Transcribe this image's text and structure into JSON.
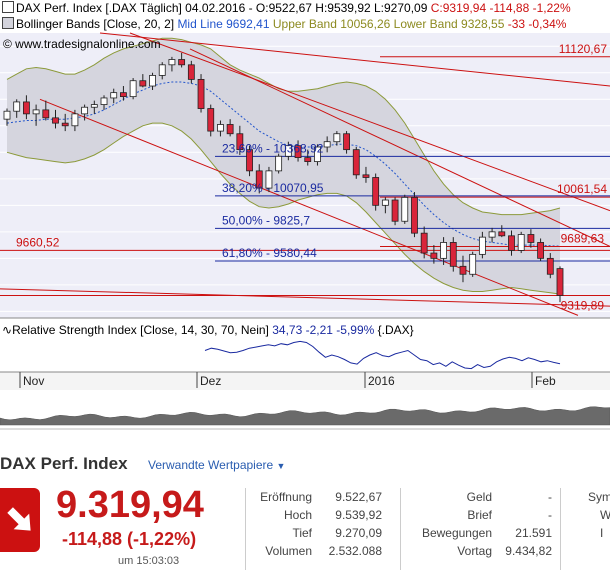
{
  "header": {
    "main_legend": "DAX Perf. Index [.DAX  Täglich] 04.02.2016 - O:9522,67 H:9539,92 L:9270,09",
    "main_legend_change": "C:9319,94 -114,88 -1,22%",
    "bollinger_label": "Bollinger Bands [Close, 20, 2]",
    "bollinger_mid": "Mid Line 9692,41",
    "bollinger_upper": "Upper Band 10056,26",
    "bollinger_lower": "Lower Band 9328,55",
    "bollinger_change": "-33 -0,34%",
    "watermark": "© www.tradesignalonline.com",
    "rsi_label": "Relative Strength Index [Close, 14, 30, 70, Nein]",
    "rsi_values": "34,73 -2,21 -5,99%",
    "rsi_symbol": "{.DAX}"
  },
  "colors": {
    "up": "#ffffff",
    "down": "#d9253a",
    "band_fill": "#d3d3dc",
    "band_line": "#8c9a3a",
    "mid_line": "#2255cc",
    "red_line": "#cc1111",
    "fib_line": "#1a2aa0",
    "rsi_line": "#1a2aa0",
    "bg": "#eeeef8"
  },
  "chart_data": {
    "type": "candlestick",
    "x_ticks": [
      "Nov",
      "Dez",
      "2016",
      "Feb"
    ],
    "price_levels": [
      {
        "label": "11120,67",
        "value": 11120.67
      },
      {
        "label": "10061,54",
        "value": 10061.54
      },
      {
        "label": "9689,63",
        "value": 9689.63
      },
      {
        "label": "9660,52",
        "value": 9660.52
      },
      {
        "label": "9319,89",
        "value": 9319.89
      }
    ],
    "fibonacci": [
      {
        "label": "23,60% - 10368,92",
        "value": 10368.92
      },
      {
        "label": "38,20% - 10070,95",
        "value": 10070.95
      },
      {
        "label": "50,00% - 9825,7",
        "value": 9825.7
      },
      {
        "label": "61,80% - 9580,44",
        "value": 9580.44
      }
    ],
    "candles": [
      {
        "o": 10650,
        "h": 10730,
        "l": 10600,
        "c": 10710
      },
      {
        "o": 10710,
        "h": 10800,
        "l": 10660,
        "c": 10780
      },
      {
        "o": 10780,
        "h": 10830,
        "l": 10650,
        "c": 10690
      },
      {
        "o": 10690,
        "h": 10760,
        "l": 10600,
        "c": 10720
      },
      {
        "o": 10720,
        "h": 10790,
        "l": 10640,
        "c": 10660
      },
      {
        "o": 10660,
        "h": 10720,
        "l": 10580,
        "c": 10620
      },
      {
        "o": 10620,
        "h": 10690,
        "l": 10560,
        "c": 10600
      },
      {
        "o": 10600,
        "h": 10720,
        "l": 10560,
        "c": 10690
      },
      {
        "o": 10690,
        "h": 10760,
        "l": 10640,
        "c": 10740
      },
      {
        "o": 10740,
        "h": 10790,
        "l": 10690,
        "c": 10760
      },
      {
        "o": 10760,
        "h": 10830,
        "l": 10720,
        "c": 10810
      },
      {
        "o": 10810,
        "h": 10880,
        "l": 10770,
        "c": 10850
      },
      {
        "o": 10850,
        "h": 10900,
        "l": 10790,
        "c": 10820
      },
      {
        "o": 10820,
        "h": 10960,
        "l": 10800,
        "c": 10940
      },
      {
        "o": 10940,
        "h": 10990,
        "l": 10890,
        "c": 10900
      },
      {
        "o": 10900,
        "h": 11000,
        "l": 10870,
        "c": 10980
      },
      {
        "o": 10980,
        "h": 11080,
        "l": 10950,
        "c": 11060
      },
      {
        "o": 11060,
        "h": 11120,
        "l": 11010,
        "c": 11100
      },
      {
        "o": 11100,
        "h": 11150,
        "l": 11040,
        "c": 11060
      },
      {
        "o": 11060,
        "h": 11090,
        "l": 10920,
        "c": 10950
      },
      {
        "o": 10950,
        "h": 10990,
        "l": 10700,
        "c": 10730
      },
      {
        "o": 10730,
        "h": 10760,
        "l": 10520,
        "c": 10560
      },
      {
        "o": 10560,
        "h": 10640,
        "l": 10520,
        "c": 10610
      },
      {
        "o": 10610,
        "h": 10650,
        "l": 10520,
        "c": 10540
      },
      {
        "o": 10540,
        "h": 10600,
        "l": 10380,
        "c": 10420
      },
      {
        "o": 10420,
        "h": 10450,
        "l": 10220,
        "c": 10260
      },
      {
        "o": 10260,
        "h": 10310,
        "l": 10090,
        "c": 10130
      },
      {
        "o": 10130,
        "h": 10290,
        "l": 10100,
        "c": 10260
      },
      {
        "o": 10260,
        "h": 10390,
        "l": 10240,
        "c": 10370
      },
      {
        "o": 10370,
        "h": 10480,
        "l": 10340,
        "c": 10450
      },
      {
        "o": 10450,
        "h": 10490,
        "l": 10330,
        "c": 10360
      },
      {
        "o": 10360,
        "h": 10420,
        "l": 10300,
        "c": 10330
      },
      {
        "o": 10330,
        "h": 10460,
        "l": 10300,
        "c": 10440
      },
      {
        "o": 10440,
        "h": 10520,
        "l": 10400,
        "c": 10480
      },
      {
        "o": 10480,
        "h": 10560,
        "l": 10450,
        "c": 10540
      },
      {
        "o": 10540,
        "h": 10560,
        "l": 10390,
        "c": 10420
      },
      {
        "o": 10420,
        "h": 10440,
        "l": 10200,
        "c": 10230
      },
      {
        "o": 10230,
        "h": 10290,
        "l": 10170,
        "c": 10210
      },
      {
        "o": 10210,
        "h": 10240,
        "l": 9960,
        "c": 10000
      },
      {
        "o": 10000,
        "h": 10060,
        "l": 9940,
        "c": 10040
      },
      {
        "o": 10040,
        "h": 10060,
        "l": 9850,
        "c": 9880
      },
      {
        "o": 9880,
        "h": 10080,
        "l": 9860,
        "c": 10060
      },
      {
        "o": 10060,
        "h": 10100,
        "l": 9760,
        "c": 9790
      },
      {
        "o": 9790,
        "h": 9840,
        "l": 9600,
        "c": 9640
      },
      {
        "o": 9640,
        "h": 9700,
        "l": 9560,
        "c": 9600
      },
      {
        "o": 9600,
        "h": 9760,
        "l": 9550,
        "c": 9720
      },
      {
        "o": 9720,
        "h": 9760,
        "l": 9500,
        "c": 9540
      },
      {
        "o": 9540,
        "h": 9620,
        "l": 9420,
        "c": 9480
      },
      {
        "o": 9480,
        "h": 9650,
        "l": 9460,
        "c": 9630
      },
      {
        "o": 9630,
        "h": 9800,
        "l": 9600,
        "c": 9760
      },
      {
        "o": 9760,
        "h": 9830,
        "l": 9720,
        "c": 9800
      },
      {
        "o": 9800,
        "h": 9850,
        "l": 9760,
        "c": 9770
      },
      {
        "o": 9770,
        "h": 9810,
        "l": 9620,
        "c": 9660
      },
      {
        "o": 9660,
        "h": 9800,
        "l": 9640,
        "c": 9780
      },
      {
        "o": 9780,
        "h": 9820,
        "l": 9680,
        "c": 9720
      },
      {
        "o": 9720,
        "h": 9750,
        "l": 9580,
        "c": 9600
      },
      {
        "o": 9600,
        "h": 9640,
        "l": 9450,
        "c": 9480
      },
      {
        "o": 9522.67,
        "h": 9539.92,
        "l": 9270.09,
        "c": 9319.94
      }
    ],
    "bollinger": {
      "upper": [
        10950,
        10990,
        11030,
        11040,
        11030,
        11010,
        10990,
        10990,
        11020,
        11060,
        11110,
        11150,
        11180,
        11200,
        11220,
        11240,
        11260,
        11260,
        11250,
        11230,
        11210,
        11180,
        11120,
        11060,
        11020,
        10990,
        10960,
        10920,
        10880,
        10860,
        10860,
        10870,
        10880,
        10900,
        10920,
        10930,
        10920,
        10900,
        10860,
        10800,
        10720,
        10620,
        10500,
        10380,
        10260,
        10160,
        10080,
        10020,
        9980,
        9950,
        9940,
        9930,
        9930,
        9930,
        9940,
        9950,
        9960,
        9980
      ],
      "lower": [
        10400,
        10380,
        10360,
        10350,
        10340,
        10330,
        10320,
        10330,
        10350,
        10380,
        10420,
        10470,
        10520,
        10560,
        10600,
        10620,
        10620,
        10600,
        10560,
        10500,
        10420,
        10330,
        10240,
        10160,
        10090,
        10030,
        9990,
        9980,
        9990,
        10010,
        10040,
        10060,
        10080,
        10090,
        10090,
        10070,
        10020,
        9950,
        9870,
        9790,
        9710,
        9630,
        9560,
        9500,
        9450,
        9410,
        9380,
        9360,
        9350,
        9350,
        9360,
        9370,
        9380,
        9370,
        9360,
        9350,
        9340,
        9330
      ],
      "mid": [
        10620,
        10630,
        10640,
        10640,
        10650,
        10650,
        10650,
        10660,
        10670,
        10690,
        10720,
        10760,
        10800,
        10840,
        10870,
        10900,
        10920,
        10930,
        10930,
        10920,
        10900,
        10860,
        10800,
        10740,
        10680,
        10620,
        10560,
        10520,
        10480,
        10450,
        10440,
        10440,
        10440,
        10450,
        10460,
        10460,
        10450,
        10420,
        10370,
        10310,
        10240,
        10160,
        10080,
        10000,
        9930,
        9870,
        9820,
        9780,
        9750,
        9730,
        9720,
        9710,
        9700,
        9700,
        9700,
        9700,
        9695,
        9692
      ]
    },
    "rsi": [
      58,
      62,
      60,
      57,
      54,
      55,
      58,
      62,
      64,
      66,
      68,
      66,
      70,
      68,
      72,
      74,
      72,
      65,
      55,
      46,
      50,
      47,
      42,
      36,
      34,
      44,
      50,
      54,
      49,
      47,
      52,
      55,
      58,
      50,
      42,
      40,
      33,
      36,
      30,
      38,
      32,
      27,
      26,
      33,
      28,
      30,
      38,
      43,
      46,
      44,
      40,
      45,
      42,
      38,
      40,
      37,
      34.73
    ],
    "rsi_dates": {
      "start": "Nov",
      "end": "Feb"
    },
    "ylim": [
      9150,
      11300
    ]
  },
  "quote": {
    "title": "DAX Perf. Index",
    "related_link": "Verwandte Wertpapiere",
    "price": "9.319,94",
    "change": "-114,88 (-1,22%)",
    "time": "um 15:03:03",
    "stats_left": [
      {
        "label": "Eröffnung",
        "value": "9.522,67"
      },
      {
        "label": "Hoch",
        "value": "9.539,92"
      },
      {
        "label": "Tief",
        "value": "9.270,09"
      },
      {
        "label": "Volumen",
        "value": "2.532.088"
      }
    ],
    "stats_mid": [
      {
        "label": "Geld",
        "value": "-"
      },
      {
        "label": "Brief",
        "value": "-"
      },
      {
        "label": "Bewegungen",
        "value": "21.591"
      },
      {
        "label": "Vortag",
        "value": "9.434,82"
      }
    ],
    "stats_right_partial": [
      "Sym",
      "W",
      "I"
    ]
  }
}
